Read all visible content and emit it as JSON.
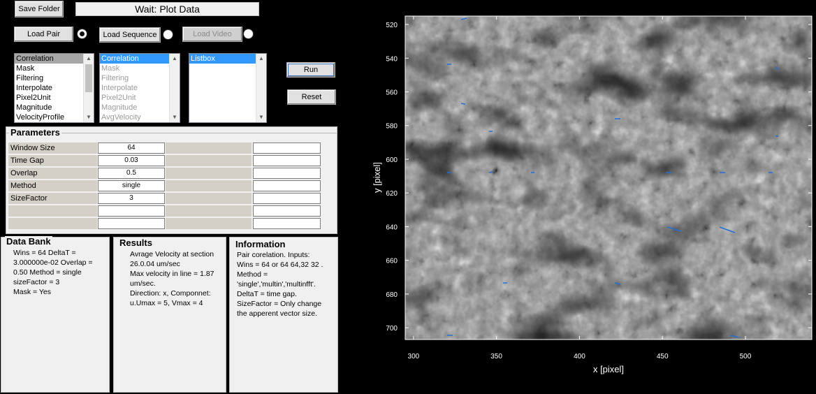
{
  "toolbar": {
    "save_folder": "Save Folder",
    "status": "Wait: Plot Data",
    "load_pair": "Load Pair",
    "load_sequence": "Load Sequence",
    "load_video": "Load Video",
    "run": "Run",
    "reset": "Reset",
    "load_pair_selected": true,
    "load_sequence_selected": false,
    "load_video_selected": false
  },
  "lists": {
    "list1": [
      "Correlation",
      "Mask",
      "Filtering",
      "Interpolate",
      "Pixel2Unit",
      "Magnitude",
      "VelocityProfile"
    ],
    "list2": [
      "Correlation",
      "Mask",
      "Filtering",
      "Interpolate",
      "Pixel2Unit",
      "Magnitude",
      "AvgVelocity"
    ],
    "list3": [
      "Listbox"
    ]
  },
  "parameters": {
    "title": "Parameters",
    "rows": [
      {
        "label": "Window Size",
        "value": "64"
      },
      {
        "label": "Time Gap",
        "value": "0.03"
      },
      {
        "label": "Overlap",
        "value": "0.5"
      },
      {
        "label": "Method",
        "value": "single"
      },
      {
        "label": "SizeFactor",
        "value": "3"
      },
      {
        "label": "",
        "value": ""
      },
      {
        "label": "",
        "value": ""
      }
    ]
  },
  "databank": {
    "title": "Data Bank",
    "lines": [
      "Wins = 64  DeltaT =",
      "3.000000e-02  Overlap =",
      "0.50  Method = single",
      "sizeFactor = 3",
      "Mask = Yes"
    ]
  },
  "results": {
    "title": "Results",
    "lines": [
      "Avrage Velocity at section",
      "26.0.04 um/sec",
      "Max velocity in line = 1.87",
      "um/sec.",
      "Direction: x,  Componnet:",
      "u.Umax = 5, Vmax = 4"
    ]
  },
  "information": {
    "title": "Information",
    "lines": [
      "Pair corelation. Inputs:",
      "Wins = 64 or 64 64,32 32 .",
      "Method =",
      "'single','multin','multinfft'.",
      "DeltaT = time gap.",
      "SizeFactor = Only change",
      "the apperent vector size."
    ]
  },
  "plot": {
    "xlabel": "x [pixel]",
    "ylabel": "y [pixel]",
    "xticks": [
      "300",
      "350",
      "400",
      "450",
      "500"
    ],
    "yticks": [
      "520",
      "540",
      "560",
      "580",
      "600",
      "620",
      "640",
      "660",
      "680",
      "700"
    ],
    "xlim": [
      295,
      540
    ],
    "ylim": [
      515,
      707
    ],
    "vector_color": "#1f6fd6"
  }
}
